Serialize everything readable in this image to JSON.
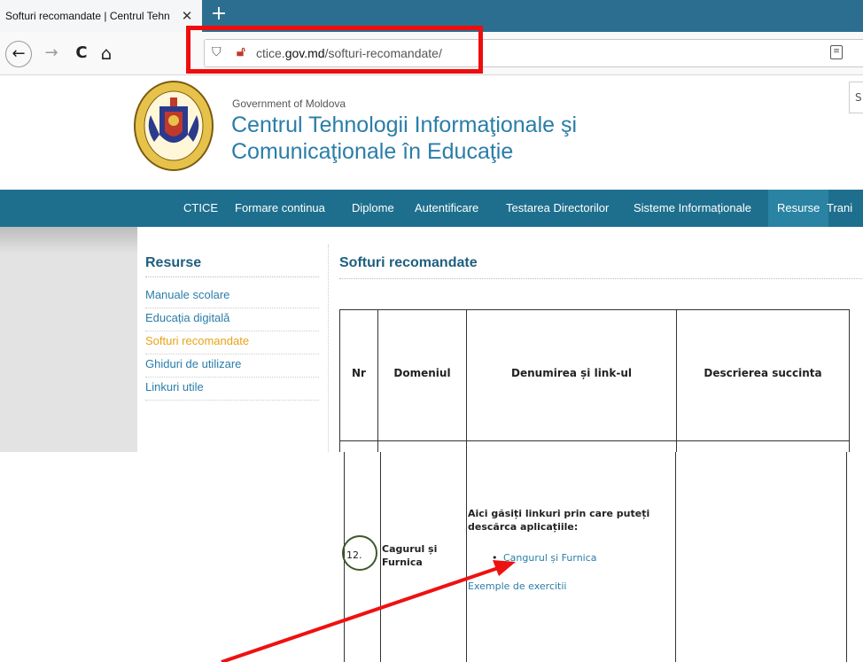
{
  "browser": {
    "tab_title": "Softuri recomandate | Centrul Tehn",
    "tab_close": "✕",
    "new_tab": "+",
    "back": "←",
    "forward": "→",
    "reload": "C",
    "home": "⌂",
    "url_prefix": "ctice.",
    "url_domain": "gov.md",
    "url_path": "/softuri-recomandate/",
    "highlight_color": "#ee0d0d"
  },
  "header": {
    "gov_label": "Government of Moldova",
    "title": "Centrul Tehnologii Informaţionale şi Comunicaţionale în Educaţie",
    "search_stub": "S"
  },
  "nav": {
    "items": [
      "CTICE",
      "Formare continua",
      "Diplome",
      "Autentificare",
      "Testarea Directorilor",
      "Sisteme Informaționale",
      "Resurse",
      "Trani"
    ],
    "active": "Resurse"
  },
  "sidebar": {
    "heading": "Resurse",
    "items": [
      "Manuale scolare",
      "Educația digitală",
      "Softuri recomandate",
      "Ghiduri de utilizare",
      "Linkuri utile"
    ],
    "current": "Softuri recomandate"
  },
  "content": {
    "heading": "Softuri recomandate",
    "table": {
      "headers": [
        "Nr",
        "Domeniul",
        "Denumirea și link-ul",
        "Descrierea succinta"
      ],
      "row": {
        "nr": "12.",
        "domain": "Cagurul și Furnica",
        "intro": "Aici găsiți linkuri prin care puteți descărca aplicațiile:",
        "link1": "Cangurul și Furnica",
        "link2": "Exemple de exercitii"
      }
    }
  },
  "annotation_color": "#ee1111"
}
